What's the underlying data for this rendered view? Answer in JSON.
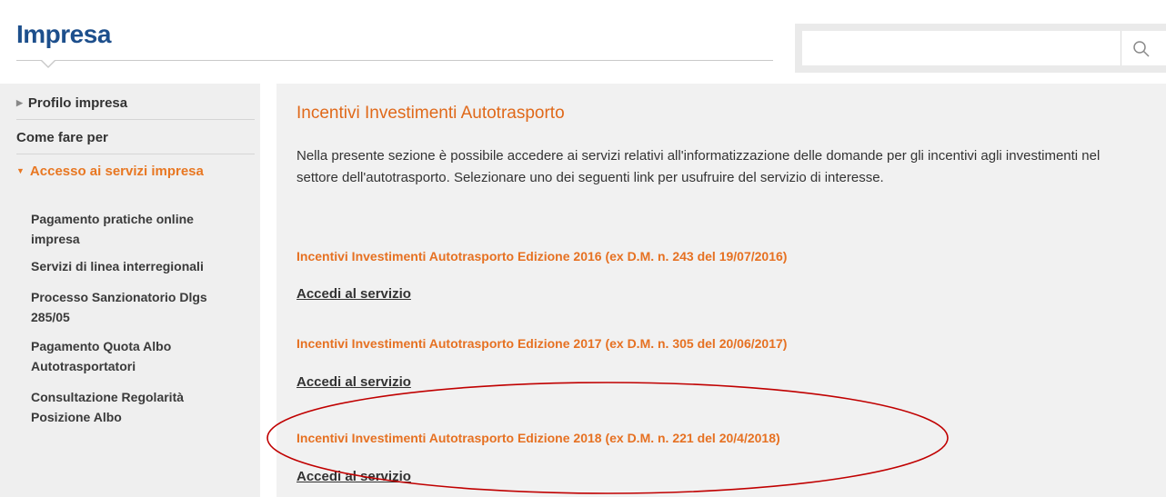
{
  "header": {
    "brand": "Impresa",
    "search": {
      "placeholder": "",
      "value": ""
    },
    "search_icon": "search-icon"
  },
  "sidebar": {
    "items": [
      {
        "label": "Profilo impresa",
        "arrow": "▶"
      },
      {
        "label": "Come fare per"
      },
      {
        "label": "Accesso ai servizi impresa",
        "arrow": "▼",
        "active": true
      }
    ],
    "subitems": [
      {
        "line1": "Pagamento pratiche online",
        "line2": "impresa"
      },
      {
        "line1": "Servizi di linea interregionali"
      },
      {
        "line1": "Processo Sanzionatorio Dlgs",
        "line2": "285/05"
      },
      {
        "line1": "Pagamento Quota Albo",
        "line2": "Autotrasportatori"
      },
      {
        "line1": "Consultazione Regolarità",
        "line2": "Posizione Albo"
      }
    ]
  },
  "main": {
    "title": "Incentivi Investimenti Autotrasporto",
    "intro": "Nella presente sezione è possibile accedere ai servizi relativi all'informatizzazione delle domande per gli incentivi agli investimenti nel settore dell'autotrasporto. Selezionare uno dei seguenti link per usufruire del servizio di interesse.",
    "editions": [
      {
        "title": "Incentivi Investimenti Autotrasporto Edizione 2016 (ex D.M. n. 243 del 19/07/2016)",
        "link": "Accedi al servizio"
      },
      {
        "title": "Incentivi Investimenti Autotrasporto Edizione 2017 (ex D.M. n. 305 del 20/06/2017)",
        "link": "Accedi al servizio"
      },
      {
        "title": "Incentivi Investimenti Autotrasporto Edizione  2018 (ex D.M. n. 221 del 20/4/2018)",
        "link": "Accedi al servizio"
      }
    ]
  },
  "colors": {
    "brand": "#1d4f8c",
    "accent": "#e87722",
    "highlight": "#c00000"
  }
}
